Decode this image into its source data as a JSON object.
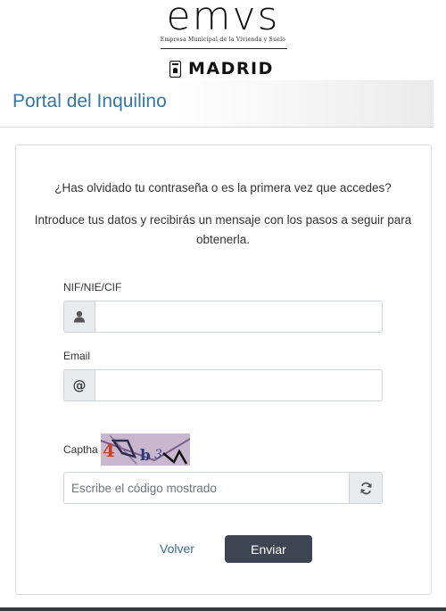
{
  "header": {
    "logo_text": "emvs",
    "logo_subtitle": "Empresa Municipal de la Vivienda y Suelo",
    "city_text": "MADRID"
  },
  "page": {
    "title": "Portal del Inquilino"
  },
  "form": {
    "question": "¿Has olvidado tu contraseña o es la primera vez que accedes?",
    "intro": "Introduce tus datos y recibirás un mensaje con los pasos a seguir para obtenerla.",
    "nif_label": "NIF/NIE/CIF",
    "nif_value": "",
    "nif_icon": "user-icon",
    "email_label": "Email",
    "email_value": "",
    "email_icon": "at-icon",
    "captcha_label": "Captha",
    "captcha_placeholder": "Escribe el código mostrado",
    "captcha_value": "",
    "refresh_icon": "refresh-icon",
    "back_label": "Volver",
    "submit_label": "Enviar"
  },
  "colors": {
    "title": "#3575a8",
    "link": "#3a6a96",
    "button": "#3d4552",
    "addon": "#e9ecef",
    "border": "#ced4da"
  }
}
